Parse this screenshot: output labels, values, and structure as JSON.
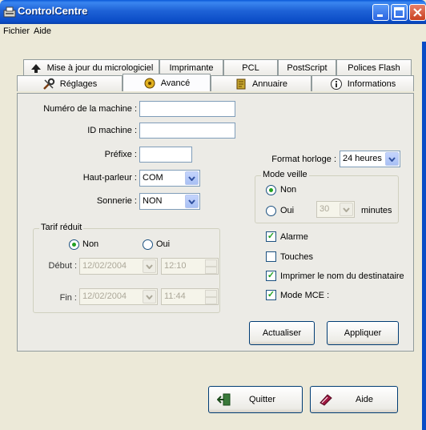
{
  "window": {
    "title": "ControlCentre",
    "icons": {
      "app": "fax-app-icon",
      "minimize": "minimize-icon",
      "maximize": "maximize-icon",
      "close": "close-icon"
    }
  },
  "menu": {
    "file": "Fichier",
    "help": "Aide"
  },
  "tabs": {
    "firmware": "Mise à jour du micrologiciel",
    "printer": "Imprimante",
    "pcl": "PCL",
    "postscript": "PostScript",
    "flash_fonts": "Polices Flash",
    "settings": "Réglages",
    "advanced": "Avancé",
    "directory": "Annuaire",
    "info": "Informations",
    "active": "Avancé"
  },
  "form": {
    "machine_number_label": "Numéro de la machine :",
    "machine_number_value": "",
    "machine_id_label": "ID machine :",
    "machine_id_value": "",
    "prefix_label": "Préfixe :",
    "prefix_value": "",
    "speaker_label": "Haut-parleur :",
    "speaker_value": "COM",
    "ringer_label": "Sonnerie :",
    "ringer_value": "NON",
    "clock_format_label": "Format horloge :",
    "clock_format_value": "24 heures"
  },
  "reduced_rate": {
    "title": "Tarif réduit",
    "no_label": "Non",
    "yes_label": "Oui",
    "selected": "Non",
    "start_label": "Début :",
    "start_date": "12/02/2004",
    "start_time": "12:10",
    "end_label": "Fin :",
    "end_date": "12/02/2004",
    "end_time": "11:44"
  },
  "sleep_mode": {
    "title": "Mode veille",
    "no_label": "Non",
    "yes_label": "Oui",
    "selected": "Non",
    "minutes_value": "30",
    "minutes_label": "minutes"
  },
  "options": {
    "alarm": {
      "label": "Alarme",
      "checked": true
    },
    "keys": {
      "label": "Touches",
      "checked": false
    },
    "print_recipient": {
      "label": "Imprimer le nom du destinataire",
      "checked": true
    },
    "mce_mode": {
      "label": "Mode MCE :",
      "checked": true
    }
  },
  "buttons": {
    "refresh": "Actualiser",
    "apply": "Appliquer",
    "quit": "Quitter",
    "help": "Aide"
  },
  "colors": {
    "titlebar": "#0a4cc6",
    "face": "#ece9d8",
    "radio_dot": "#21a121",
    "check": "#21a121"
  }
}
